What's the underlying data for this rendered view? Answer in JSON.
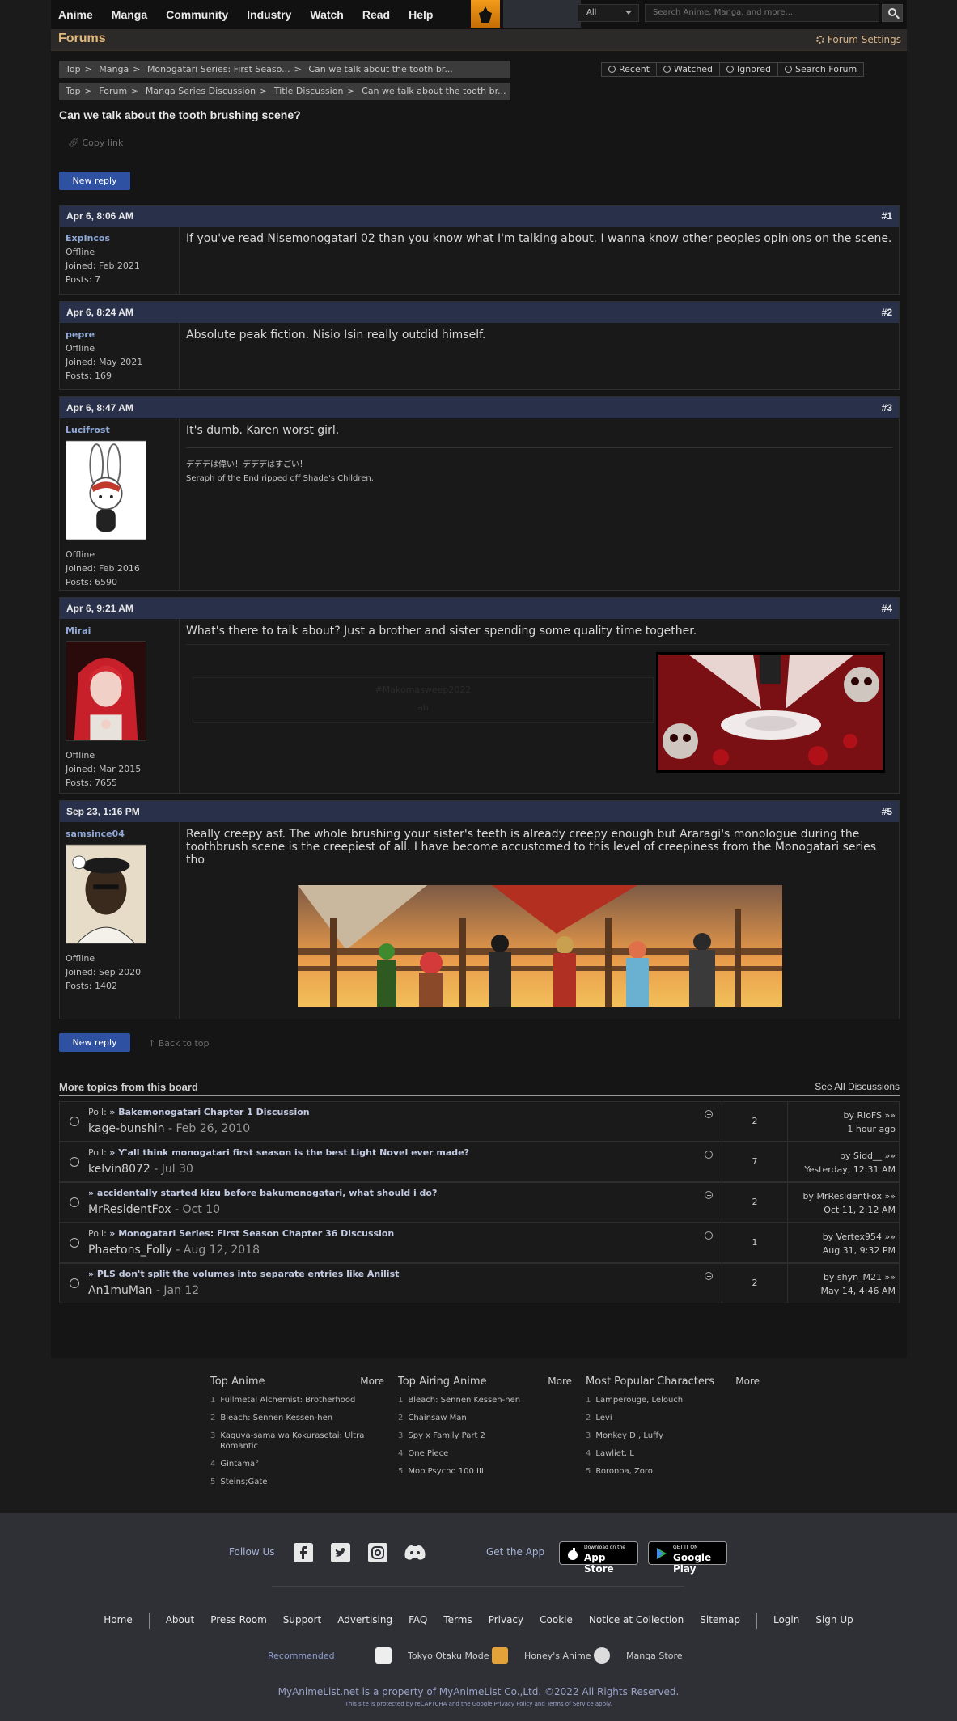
{
  "nav": {
    "items": [
      "Anime",
      "Manga",
      "Community",
      "Industry",
      "Watch",
      "Read",
      "Help"
    ],
    "search_category": "All",
    "search_placeholder": "Search Anime, Manga, and more..."
  },
  "forum_header": {
    "title": "Forums",
    "settings_label": "Forum Settings"
  },
  "breadcrumb1": [
    "Top",
    "Manga",
    "Monogatari Series: First Seaso...",
    "Can we talk about the tooth br..."
  ],
  "breadcrumb2": [
    "Top",
    "Forum",
    "Manga Series Discussion",
    "Title Discussion",
    "Can we talk about the tooth br..."
  ],
  "actions": [
    "Recent",
    "Watched",
    "Ignored",
    "Search Forum"
  ],
  "thread": {
    "title": "Can we talk about the tooth brushing scene?",
    "copy_link": "Copy link",
    "new_reply": "New reply",
    "back_to_top": "Back to top"
  },
  "posts": [
    {
      "date": "Apr 6, 8:06 AM",
      "num": "#1",
      "user": "ExpIncos",
      "status": "Offline",
      "joined": "Joined: Feb 2021",
      "posts": "Posts: 7",
      "text": "If you've read Nisemonogatari 02 than you know what I'm talking about. I wanna know other peoples opinions on the scene."
    },
    {
      "date": "Apr 6, 8:24 AM",
      "num": "#2",
      "user": "pepre",
      "status": "Offline",
      "joined": "Joined: May 2021",
      "posts": "Posts: 169",
      "text": "Absolute peak fiction. Nisio Isin really outdid himself."
    },
    {
      "date": "Apr 6, 8:47 AM",
      "num": "#3",
      "user": "Lucifrost",
      "status": "Offline",
      "joined": "Joined: Feb 2016",
      "posts": "Posts: 6590",
      "text": "It's dumb. Karen worst girl.",
      "sig1": "デデデは偉い！デデデはすごい！",
      "sig2": "Seraph of the End ripped off Shade's Children."
    },
    {
      "date": "Apr 6, 9:21 AM",
      "num": "#4",
      "user": "Mirai",
      "status": "Offline",
      "joined": "Joined: Mar 2015",
      "posts": "Posts: 7655",
      "text": "What's there to talk about? Just a brother and sister spending some quality time together.",
      "sig1": "#Makomasweep2022",
      "sig2": "ah"
    },
    {
      "date": "Sep 23, 1:16 PM",
      "num": "#5",
      "user": "samsince04",
      "status": "Offline",
      "joined": "Joined: Sep 2020",
      "posts": "Posts: 1402",
      "text": "Really creepy asf. The whole brushing your sister's teeth is already creepy enough but Araragi's monologue during the toothbrush scene is the creepiest of all. I have become accustomed to this level of creepiness from the Monogatari series tho"
    }
  ],
  "more": {
    "title": "More topics from this board",
    "see_all": "See All Discussions",
    "rows": [
      {
        "poll": "Poll: ",
        "title": "» Bakemonogatari Chapter 1 Discussion",
        "author": "kage-bunshin",
        "date": "Feb 26, 2010",
        "replies": "2",
        "last_by": "by RioFS »»",
        "last_time": "1 hour ago"
      },
      {
        "poll": "Poll: ",
        "title": "» Y'all think monogatari first season is the best Light Novel ever made?",
        "author": "kelvin8072",
        "date": "Jul 30",
        "replies": "7",
        "last_by": "by Sidd__ »»",
        "last_time": "Yesterday, 12:31 AM"
      },
      {
        "poll": "",
        "title": "» accidentally started kizu before bakumonogatari, what should i do?",
        "author": "MrResidentFox",
        "date": "Oct 10",
        "replies": "2",
        "last_by": "by MrResidentFox »»",
        "last_time": "Oct 11, 2:12 AM"
      },
      {
        "poll": "Poll: ",
        "title": "» Monogatari Series: First Season Chapter 36 Discussion",
        "author": "Phaetons_Folly",
        "date": "Aug 12, 2018",
        "replies": "1",
        "last_by": "by Vertex954 »»",
        "last_time": "Aug 31, 9:32 PM"
      },
      {
        "poll": "",
        "title": "» PLS don't split the volumes into separate entries like Anilist",
        "author": "An1muMan",
        "date": "Jan 12",
        "replies": "2",
        "last_by": "by shyn_M21 »»",
        "last_time": "May 14, 4:46 AM"
      }
    ]
  },
  "footer": {
    "cols": [
      {
        "title": "Top Anime",
        "more": "More",
        "items": [
          "Fullmetal Alchemist: Brotherhood",
          "Bleach: Sennen Kessen-hen",
          "Kaguya-sama wa Kokurasetai: Ultra Romantic",
          "Gintama°",
          "Steins;Gate"
        ]
      },
      {
        "title": "Top Airing Anime",
        "more": "More",
        "items": [
          "Bleach: Sennen Kessen-hen",
          "Chainsaw Man",
          "Spy x Family Part 2",
          "One Piece",
          "Mob Psycho 100 III"
        ]
      },
      {
        "title": "Most Popular Characters",
        "more": "More",
        "items": [
          "Lamperouge, Lelouch",
          "Levi",
          "Monkey D., Luffy",
          "Lawliet, L",
          "Roronoa, Zoro"
        ]
      }
    ],
    "follow_us": "Follow Us",
    "get_app": "Get the App",
    "app_store_small": "Download on the",
    "app_store": "App Store",
    "play_small": "GET IT ON",
    "play": "Google Play",
    "links": [
      "Home",
      "About",
      "Press Room",
      "Support",
      "Advertising",
      "FAQ",
      "Terms",
      "Privacy",
      "Cookie",
      "Notice at Collection",
      "Sitemap",
      "Login",
      "Sign Up"
    ],
    "recommended": "Recommended",
    "rec_items": [
      "Tokyo Otaku Mode",
      "Honey's Anime",
      "Manga Store"
    ],
    "copyright": "MyAnimeList.net is a property of MyAnimeList Co.,Ltd. ©2022 All Rights Reserved.",
    "recaptcha": "This site is protected by reCAPTCHA and the Google Privacy Policy and Terms of Service apply."
  }
}
